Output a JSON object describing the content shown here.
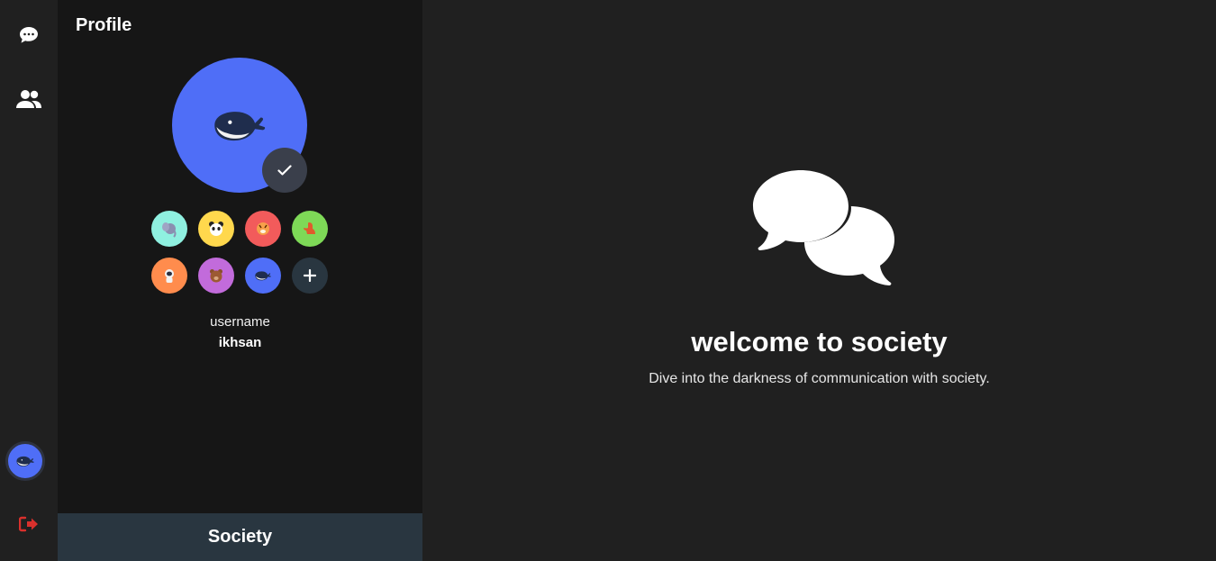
{
  "rail": {
    "icons": {
      "chat": "chat-bubble-icon",
      "friends": "users-icon",
      "avatar": "whale-avatar",
      "logout": "logout-icon"
    },
    "colors": {
      "logout": "#d9302c",
      "avatar_bg": "#4f6ef7"
    }
  },
  "profile": {
    "title": "Profile",
    "current_avatar": {
      "animal": "whale",
      "bg": "#4f6ef7"
    },
    "confirm_icon": "checkmark-icon",
    "avatar_options": [
      {
        "animal": "elephant",
        "bg": "#8ff0e0"
      },
      {
        "animal": "panda",
        "bg": "#ffd84d"
      },
      {
        "animal": "tiger",
        "bg": "#f25b5b"
      },
      {
        "animal": "dinosaur",
        "bg": "#7ed957"
      },
      {
        "animal": "astronaut",
        "bg": "#ff8c4d"
      },
      {
        "animal": "bear",
        "bg": "#c26bdb"
      },
      {
        "animal": "whale",
        "bg": "#4f6ef7"
      },
      {
        "animal": "add",
        "bg": "#293640"
      }
    ],
    "username_label": "username",
    "username_value": "ikhsan"
  },
  "brand": {
    "name": "Society",
    "bg": "#293640"
  },
  "welcome": {
    "icon": "chat-bubbles-icon",
    "title": "welcome to society",
    "subtitle": "Dive into the darkness of communication with society."
  }
}
